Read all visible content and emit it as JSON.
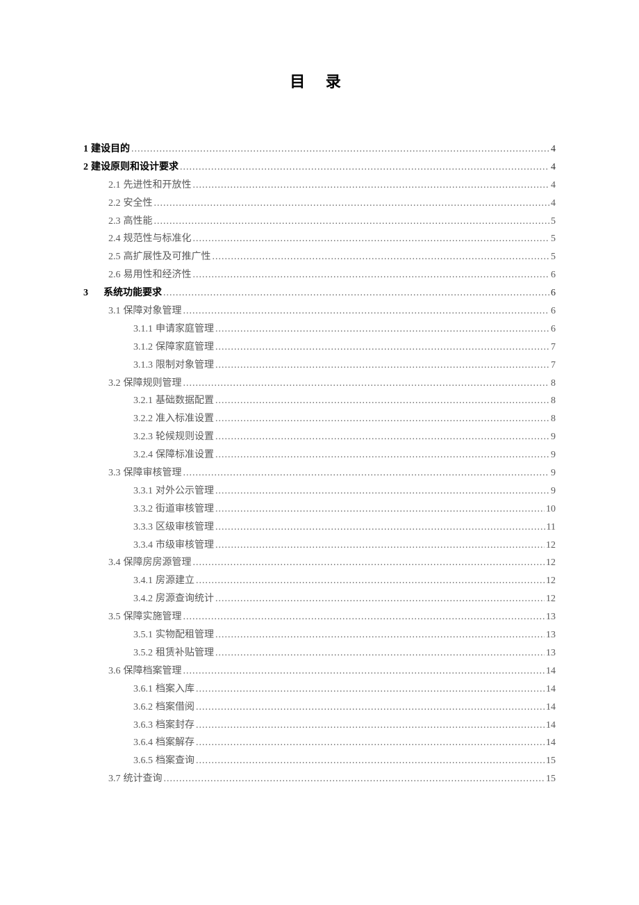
{
  "title": "目 录",
  "entries": [
    {
      "level": 1,
      "num": "1",
      "label": "建设目的",
      "page": "4",
      "extraClass": ""
    },
    {
      "level": 1,
      "num": "2",
      "label": "建设原则和设计要求",
      "page": "4",
      "extraClass": ""
    },
    {
      "level": 2,
      "num": "2.1",
      "label": "先进性和开放性",
      "page": "4"
    },
    {
      "level": 2,
      "num": "2.2",
      "label": "安全性",
      "page": "4"
    },
    {
      "level": 2,
      "num": "2.3",
      "label": "高性能",
      "page": "5"
    },
    {
      "level": 2,
      "num": "2.4",
      "label": "规范性与标准化",
      "page": "5"
    },
    {
      "level": 2,
      "num": "2.5",
      "label": "高扩展性及可推广性",
      "page": "5"
    },
    {
      "level": 2,
      "num": "2.6",
      "label": "易用性和经济性",
      "page": "6"
    },
    {
      "level": 1,
      "num": "3",
      "label": "系统功能要求",
      "page": "6",
      "extraClass": "section-3"
    },
    {
      "level": 2,
      "num": "3.1",
      "label": "保障对象管理",
      "page": "6"
    },
    {
      "level": 3,
      "num": "3.1.1",
      "label": "申请家庭管理",
      "page": "6"
    },
    {
      "level": 3,
      "num": "3.1.2",
      "label": "保障家庭管理",
      "page": "7"
    },
    {
      "level": 3,
      "num": "3.1.3",
      "label": "限制对象管理",
      "page": "7"
    },
    {
      "level": 2,
      "num": "3.2",
      "label": "保障规则管理",
      "page": "8"
    },
    {
      "level": 3,
      "num": "3.2.1",
      "label": "基础数据配置",
      "page": "8"
    },
    {
      "level": 3,
      "num": "3.2.2",
      "label": "准入标准设置",
      "page": "8"
    },
    {
      "level": 3,
      "num": "3.2.3",
      "label": "轮候规则设置",
      "page": "9"
    },
    {
      "level": 3,
      "num": "3.2.4",
      "label": "保障标准设置",
      "page": "9"
    },
    {
      "level": 2,
      "num": "3.3",
      "label": "保障审核管理",
      "page": "9"
    },
    {
      "level": 3,
      "num": "3.3.1",
      "label": " 对外公示管理",
      "page": "9"
    },
    {
      "level": 3,
      "num": "3.3.2",
      "label": "街道审核管理",
      "page": "10"
    },
    {
      "level": 3,
      "num": "3.3.3",
      "label": "区级审核管理",
      "page": "11"
    },
    {
      "level": 3,
      "num": "3.3.4",
      "label": "市级审核管理",
      "page": "12"
    },
    {
      "level": 2,
      "num": "3.4",
      "label": "保障房房源管理",
      "page": "12"
    },
    {
      "level": 3,
      "num": "3.4.1",
      "label": "房源建立",
      "page": "12"
    },
    {
      "level": 3,
      "num": "3.4.2",
      "label": "房源查询统计",
      "page": "12"
    },
    {
      "level": 2,
      "num": "3.5",
      "label": "保障实施管理",
      "page": "13"
    },
    {
      "level": 3,
      "num": "3.5.1",
      "label": "实物配租管理",
      "page": "13"
    },
    {
      "level": 3,
      "num": "3.5.2",
      "label": "租赁补贴管理",
      "page": "13"
    },
    {
      "level": 2,
      "num": "3.6",
      "label": "保障档案管理",
      "page": "14"
    },
    {
      "level": 3,
      "num": "3.6.1",
      "label": "档案入库",
      "page": "14"
    },
    {
      "level": 3,
      "num": "3.6.2",
      "label": "档案借阅",
      "page": "14"
    },
    {
      "level": 3,
      "num": "3.6.3",
      "label": "档案封存",
      "page": "14"
    },
    {
      "level": 3,
      "num": "3.6.4",
      "label": "档案解存",
      "page": "14"
    },
    {
      "level": 3,
      "num": "3.6.5",
      "label": "档案查询",
      "page": "15"
    },
    {
      "level": 2,
      "num": "3.7",
      "label": "统计查询",
      "page": "15"
    }
  ]
}
